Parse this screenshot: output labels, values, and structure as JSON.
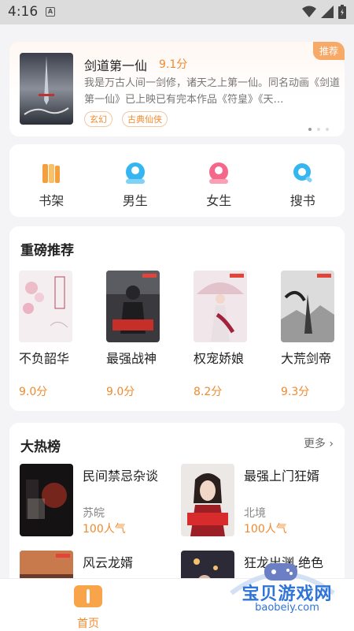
{
  "status": {
    "time": "4:16"
  },
  "featured": {
    "title": "剑道第一仙",
    "score": "9.1分",
    "badge": "推荐",
    "description": "我是万古人间一剑修，诸天之上第一仙。同名动画《剑道第一仙》已上映已有完本作品《符皇》《天…",
    "tags": [
      "玄幻",
      "古典仙侠"
    ]
  },
  "nav": [
    {
      "label": "书架",
      "icon": "bookshelf-icon",
      "color": "#f5a03c"
    },
    {
      "label": "男生",
      "icon": "male-avatar-icon",
      "color": "#35b6f0"
    },
    {
      "label": "女生",
      "icon": "female-avatar-icon",
      "color": "#f5688a"
    },
    {
      "label": "搜书",
      "icon": "search-icon",
      "color": "#35b6f0"
    }
  ],
  "recommend": {
    "title": "重磅推荐",
    "books": [
      {
        "title": "不负韶华",
        "score": "9.0分"
      },
      {
        "title": "最强战神",
        "score": "9.0分"
      },
      {
        "title": "权宠娇娘",
        "score": "8.2分"
      },
      {
        "title": "大荒剑帝",
        "score": "9.3分"
      }
    ]
  },
  "hot": {
    "title": "大热榜",
    "more": "更多",
    "books": [
      {
        "title": "民间禁忌杂谈",
        "author": "苏皖",
        "popularity": "100人气"
      },
      {
        "title": "最强上门狂婿",
        "author": "北境",
        "popularity": "100人气"
      },
      {
        "title": "风云龙婿",
        "author": "",
        "popularity": ""
      },
      {
        "title": "狂龙出渊,绝色",
        "author": "",
        "popularity": ""
      }
    ]
  },
  "tabbar": {
    "home": "首页",
    "home_color": "#f08a2e"
  },
  "watermark": {
    "text": "宝贝游戏网",
    "url": "baobeiy.com"
  }
}
